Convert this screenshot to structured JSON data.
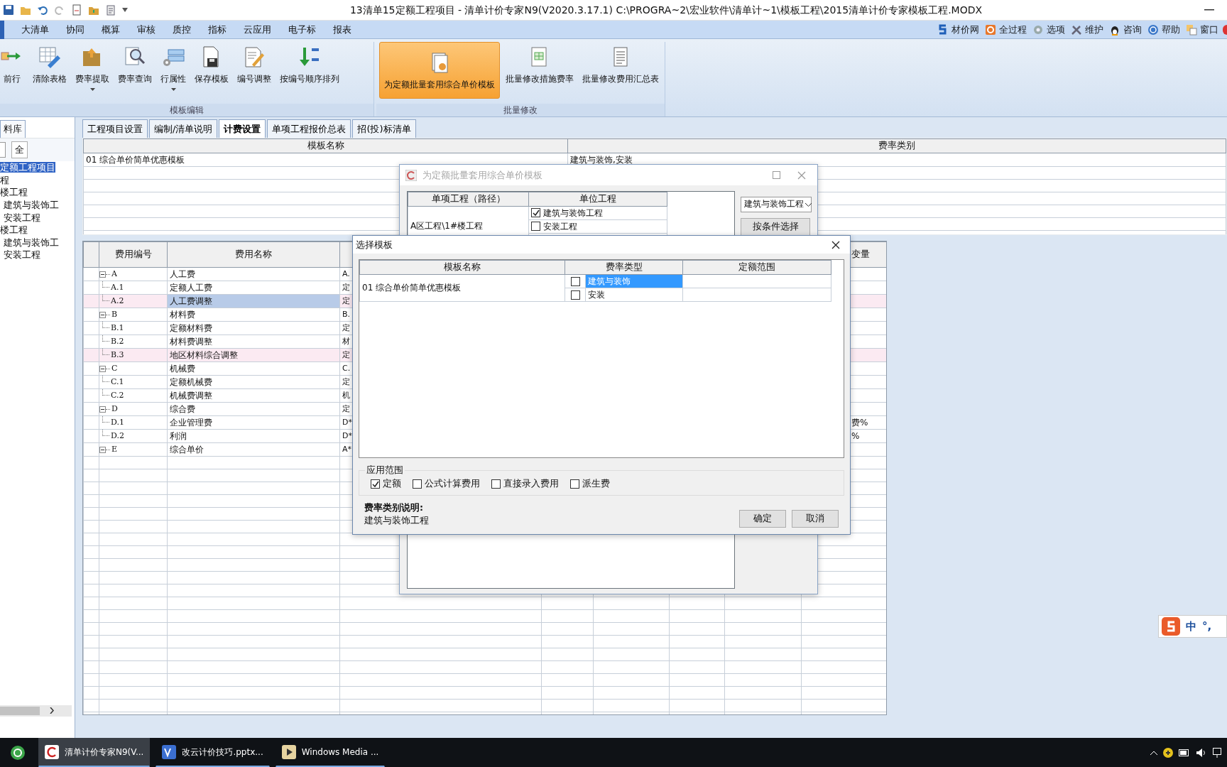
{
  "window": {
    "title": "13清单15定额工程项目 - 清单计价专家N9(V2020.3.17.1) C:\\PROGRA~2\\宏业软件\\清单计~1\\模板工程\\2015清单计价专家模板工程.MODX"
  },
  "menu": [
    {
      "label": "大清单"
    },
    {
      "label": "协同"
    },
    {
      "label": "概算"
    },
    {
      "label": "审核"
    },
    {
      "label": "质控"
    },
    {
      "label": "指标"
    },
    {
      "label": "云应用"
    },
    {
      "label": "电子标"
    },
    {
      "label": "报表"
    }
  ],
  "right_menu": [
    {
      "label": "材价网"
    },
    {
      "label": "全过程"
    },
    {
      "label": "选项"
    },
    {
      "label": "维护"
    },
    {
      "label": "咨询"
    },
    {
      "label": "帮助"
    },
    {
      "label": "窗口"
    }
  ],
  "ribbon": {
    "groups": [
      {
        "label": "模板编辑",
        "buttons": [
          {
            "label": "前行",
            "dropdown": false,
            "active": false
          },
          {
            "label": "清除表格",
            "dropdown": false,
            "active": false
          },
          {
            "label": "费率提取",
            "dropdown": true,
            "active": false
          },
          {
            "label": "费率查询",
            "dropdown": false,
            "active": false
          },
          {
            "label": "行属性",
            "dropdown": true,
            "active": false
          },
          {
            "label": "保存模板",
            "dropdown": false,
            "active": false
          },
          {
            "label": "编号调整",
            "dropdown": false,
            "active": false
          },
          {
            "label": "按编号顺序排列",
            "dropdown": false,
            "active": false
          }
        ]
      },
      {
        "label": "批量修改",
        "buttons": [
          {
            "label": "为定额批量套用综合单价模板",
            "dropdown": false,
            "active": true
          },
          {
            "label": "批量修改措施费率",
            "dropdown": false,
            "active": false
          },
          {
            "label": "批量修改费用汇总表",
            "dropdown": false,
            "active": false
          }
        ]
      }
    ]
  },
  "left_panel": {
    "tab": "料库",
    "all_button": "全",
    "tree": [
      {
        "label": "定额工程项目",
        "selected": true,
        "children": [
          {
            "label": "程",
            "selected": false,
            "children": [
              {
                "label": "楼工程",
                "selected": false,
                "children": [
                  {
                    "label": "建筑与装饰工",
                    "selected": false
                  },
                  {
                    "label": "安装工程",
                    "selected": false
                  }
                ]
              },
              {
                "label": "楼工程",
                "selected": false,
                "children": [
                  {
                    "label": "建筑与装饰工",
                    "selected": false
                  },
                  {
                    "label": "安装工程",
                    "selected": false
                  }
                ]
              }
            ]
          }
        ]
      }
    ]
  },
  "tabs": [
    {
      "label": "工程项目设置",
      "selected": false
    },
    {
      "label": "编制/清单说明",
      "selected": false
    },
    {
      "label": "计费设置",
      "selected": true
    },
    {
      "label": "单项工程报价总表",
      "selected": false
    },
    {
      "label": "招(投)标清单",
      "selected": false
    }
  ],
  "template_table": {
    "columns": [
      "模板名称",
      "费率类别"
    ],
    "rows": [
      {
        "name": "01 综合单价简单优惠模板",
        "fee_category": "建筑与装饰,安装"
      }
    ]
  },
  "fee_table": {
    "headers": {
      "code": "费用编号",
      "name": "费用名称",
      "column_9": "变量"
    },
    "rows": [
      {
        "code": "A",
        "name": "人工费",
        "column_4": "A.",
        "selected": false,
        "highlighted": false,
        "expanded": true,
        "children": [
          {
            "code": "A.1",
            "name": "定额人工费",
            "column_4": "定",
            "selected": false,
            "highlighted": false
          },
          {
            "code": "A.2",
            "name": "人工费调整",
            "column_4": "定",
            "selected": true,
            "highlighted": true
          }
        ]
      },
      {
        "code": "B",
        "name": "材料费",
        "column_4": "B.",
        "selected": false,
        "highlighted": false,
        "expanded": true,
        "children": [
          {
            "code": "B.1",
            "name": "定额材料费",
            "column_4": "定",
            "selected": false,
            "highlighted": false
          },
          {
            "code": "B.2",
            "name": "材料费调整",
            "column_4": "材",
            "selected": false,
            "highlighted": false
          },
          {
            "code": "B.3",
            "name": "地区材料综合调整",
            "column_4": "定",
            "selected": false,
            "highlighted": true
          }
        ]
      },
      {
        "code": "C",
        "name": "机械费",
        "column_4": "C.",
        "selected": false,
        "highlighted": false,
        "expanded": true,
        "children": [
          {
            "code": "C.1",
            "name": "定额机械费",
            "column_4": "定",
            "selected": false,
            "highlighted": false
          },
          {
            "code": "C.2",
            "name": "机械费调整",
            "column_4": "机",
            "selected": false,
            "highlighted": false
          }
        ]
      },
      {
        "code": "D",
        "name": "综合费",
        "column_4": "定",
        "selected": false,
        "highlighted": false,
        "expanded": true,
        "children": [
          {
            "code": "D.1",
            "name": "企业管理费",
            "column_4": "D*",
            "column_9": "费%",
            "selected": false,
            "highlighted": false
          },
          {
            "code": "D.2",
            "name": "利润",
            "column_4": "D*",
            "column_9": "%",
            "selected": false,
            "highlighted": false
          }
        ]
      },
      {
        "code": "E",
        "name": "综合单价",
        "column_4": "A*",
        "selected": false,
        "highlighted": false,
        "expanded": true
      }
    ]
  },
  "batch_dialog": {
    "title": "为定额批量套用综合单价模板",
    "columns": [
      "单项工程（路径）",
      "单位工程"
    ],
    "rows": [
      {
        "path": "A区工程\\1#楼工程",
        "units": [
          {
            "label": "建筑与装饰工程",
            "checked": true
          },
          {
            "label": "安装工程",
            "checked": false
          }
        ]
      }
    ],
    "dropdown": "建筑与装饰工程",
    "filter_button": "按条件选择"
  },
  "select_dialog": {
    "title": "选择模板",
    "columns": [
      "模板名称",
      "费率类型",
      "定额范围"
    ],
    "rows": [
      {
        "name": "01 综合单价简单优惠模板",
        "rate_types": [
          {
            "label": "建筑与装饰",
            "checked": false,
            "selected": true
          },
          {
            "label": "安装",
            "checked": false,
            "selected": false
          }
        ]
      }
    ],
    "scope": {
      "label": "应用范围",
      "options": [
        {
          "label": "定额",
          "checked": true
        },
        {
          "label": "公式计算费用",
          "checked": false
        },
        {
          "label": "直接录入费用",
          "checked": false
        },
        {
          "label": "派生费",
          "checked": false
        }
      ]
    },
    "description_label": "费率类别说明:",
    "description": "建筑与装饰工程",
    "buttons": [
      "确定",
      "取消"
    ]
  },
  "ime": {
    "mode": "中",
    "punctuation": "°,"
  },
  "taskbar": {
    "items": [
      {
        "label": "清单计价专家N9(V...",
        "selected": true
      },
      {
        "label": "改云计价技巧.pptx...",
        "selected": false
      },
      {
        "label": "Windows Media ...",
        "selected": false
      }
    ]
  }
}
